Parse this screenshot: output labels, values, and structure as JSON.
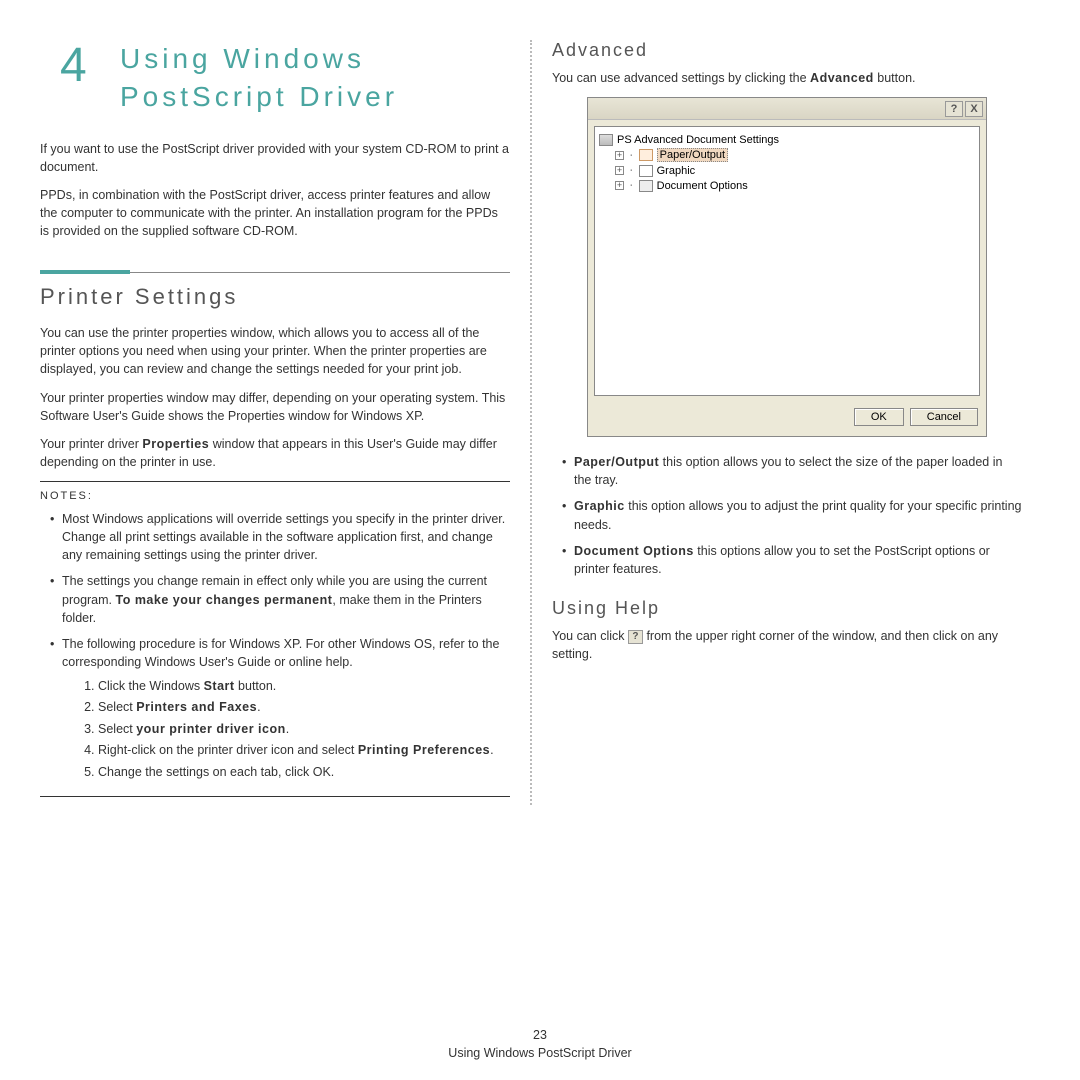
{
  "chapter": {
    "num": "4",
    "title": "Using Windows PostScript Driver"
  },
  "left": {
    "p1": "If you want to use the PostScript driver provided with your system CD-ROM to print a document.",
    "p2": "PPDs, in combination with the PostScript driver, access printer features and allow the computer to communicate with the printer. An installation program for the PPDs is provided on the supplied software CD-ROM.",
    "h2": "Printer Settings",
    "p3": "You can use the printer properties window, which allows you to access all of the printer options you need when using your printer. When the printer properties are displayed, you can review and change the settings needed for your print job.",
    "p4": "Your printer properties window may differ, depending on your operating system. This Software User's Guide shows the Properties window for Windows XP.",
    "p5_a": "Your printer driver ",
    "p5_bold": "Properties",
    "p5_b": " window that appears in this User's Guide may differ depending on the printer in use.",
    "notes_label": "NOTES:",
    "note1": "Most Windows applications will override settings you specify in the printer driver. Change all print settings available in the software application first, and change any remaining settings using the printer driver.",
    "note2_a": "The settings you change remain in effect only while you are using the current program. ",
    "note2_bold": "To make your changes permanent",
    "note2_b": ", make them in the Printers folder.",
    "note3": "The following procedure is for Windows XP. For other Windows OS, refer to the corresponding Windows User's Guide or online help.",
    "step1_a": "Click the Windows ",
    "step1_bold": "Start",
    "step1_b": " button.",
    "step2_a": "Select ",
    "step2_bold": "Printers and Faxes",
    "step2_b": ".",
    "step3_a": "Select ",
    "step3_bold": "your printer driver icon",
    "step3_b": ".",
    "step4_a": "Right-click on the printer driver icon and select ",
    "step4_bold": "Printing Preferences",
    "step4_b": ".",
    "step5": "Change the settings on each tab, click OK."
  },
  "right": {
    "h3a": "Advanced",
    "adv_p_a": "You can use advanced settings by clicking the ",
    "adv_p_bold": "Advanced",
    "adv_p_b": " button.",
    "tree_root": "PS Advanced Document Settings",
    "tree_paper": "Paper/Output",
    "tree_graphic": "Graphic",
    "tree_docopt": "Document Options",
    "btn_ok": "OK",
    "btn_cancel": "Cancel",
    "b1_bold": "Paper/Output",
    "b1": " this option allows you to select the size of the paper loaded in the tray.",
    "b2_bold": "Graphic",
    "b2": " this option allows you to adjust the print quality for your specific printing needs.",
    "b3_bold": "Document Options",
    "b3": " this options allow you to set the PostScript options or printer features.",
    "h3b": "Using Help",
    "help_a": "You can click ",
    "help_b": " from the upper right corner of the window, and then click on any setting."
  },
  "footer": {
    "page": "23",
    "text": "Using Windows PostScript Driver"
  },
  "icons": {
    "help_glyph": "?",
    "close_glyph": "X",
    "plus": "+"
  }
}
